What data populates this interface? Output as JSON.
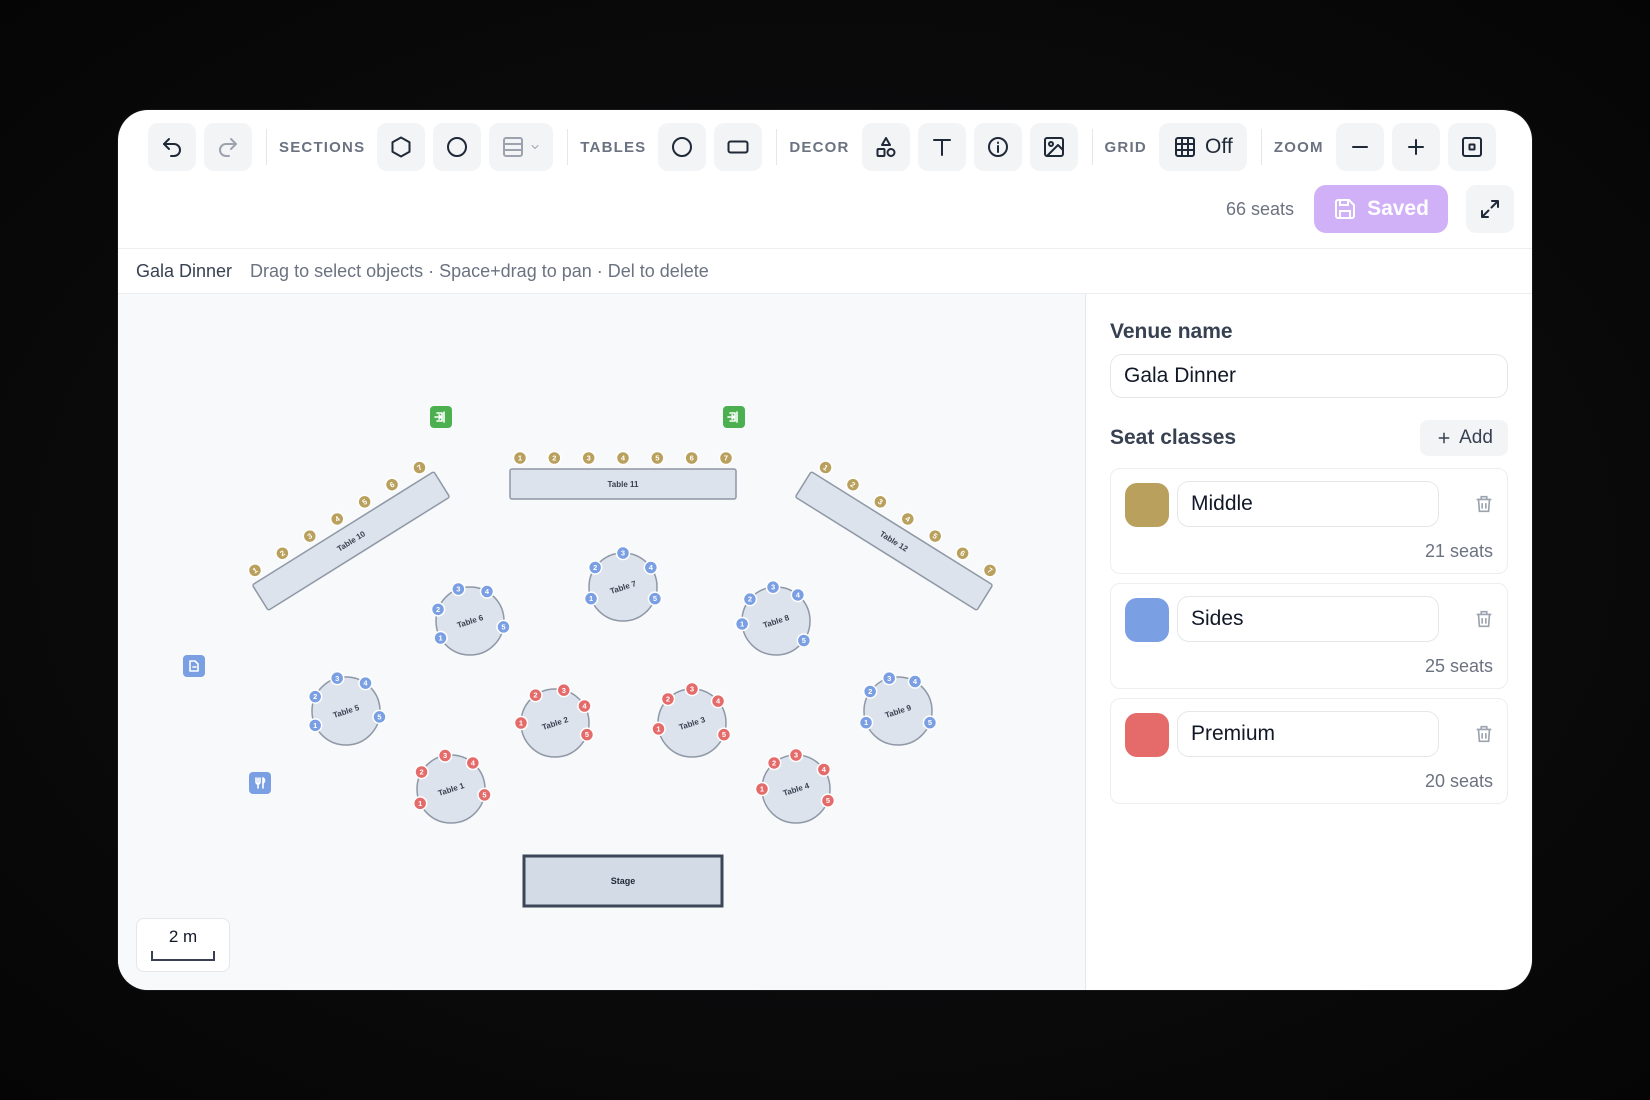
{
  "toolbar": {
    "sections_label": "SECTIONS",
    "tables_label": "TABLES",
    "decor_label": "DECOR",
    "grid_label": "GRID",
    "grid_state": "Off",
    "zoom_label": "ZOOM",
    "seat_count": "66 seats",
    "saved_label": "Saved",
    "saved_color": "#d0b0f7"
  },
  "infobar": {
    "venue": "Gala Dinner",
    "hint": "Drag to select objects · Space+drag to pan · Del to delete"
  },
  "panel": {
    "venue_heading": "Venue name",
    "venue_value": "Gala Dinner",
    "classes_heading": "Seat classes",
    "add_label": "Add",
    "classes": [
      {
        "name": "Middle",
        "count": "21 seats",
        "color": "#b9a05c"
      },
      {
        "name": "Sides",
        "count": "25 seats",
        "color": "#7b9fe3"
      },
      {
        "name": "Premium",
        "count": "20 seats",
        "color": "#e56b6b"
      }
    ]
  },
  "plan": {
    "scale_label": "2 m",
    "stage_label": "Stage",
    "colors": {
      "middle": "#b9a05c",
      "sides": "#7b9fe3",
      "premium": "#e56b6b",
      "exit": "#4caf50"
    },
    "tables": [
      {
        "label": "Table 11",
        "kind": "rect",
        "class": "middle",
        "seats": [
          "1",
          "2",
          "3",
          "4",
          "5",
          "6",
          "7"
        ]
      },
      {
        "label": "Table 10",
        "kind": "rect",
        "class": "middle",
        "seats": [
          "1",
          "2",
          "3",
          "4",
          "5",
          "6",
          "7"
        ]
      },
      {
        "label": "Table 12",
        "kind": "rect",
        "class": "middle",
        "seats": [
          "1",
          "2",
          "3",
          "4",
          "5",
          "6",
          "7"
        ]
      },
      {
        "label": "Table 7",
        "kind": "round",
        "class": "sides",
        "seats": [
          "1",
          "2",
          "3",
          "4",
          "5"
        ]
      },
      {
        "label": "Table 6",
        "kind": "round",
        "class": "sides",
        "seats": [
          "1",
          "2",
          "3",
          "4",
          "5"
        ]
      },
      {
        "label": "Table 8",
        "kind": "round",
        "class": "sides",
        "seats": [
          "1",
          "2",
          "3",
          "4",
          "5"
        ]
      },
      {
        "label": "Table 5",
        "kind": "round",
        "class": "sides",
        "seats": [
          "1",
          "2",
          "3",
          "4",
          "5"
        ]
      },
      {
        "label": "Table 9",
        "kind": "round",
        "class": "sides",
        "seats": [
          "1",
          "2",
          "3",
          "4",
          "5"
        ]
      },
      {
        "label": "Table 2",
        "kind": "round",
        "class": "premium",
        "seats": [
          "1",
          "2",
          "3",
          "4",
          "5"
        ]
      },
      {
        "label": "Table 3",
        "kind": "round",
        "class": "premium",
        "seats": [
          "1",
          "2",
          "3",
          "4",
          "5"
        ]
      },
      {
        "label": "Table 1",
        "kind": "round",
        "class": "premium",
        "seats": [
          "1",
          "2",
          "3",
          "4",
          "5"
        ]
      },
      {
        "label": "Table 4",
        "kind": "round",
        "class": "premium",
        "seats": [
          "1",
          "2",
          "3",
          "4",
          "5"
        ]
      }
    ]
  }
}
